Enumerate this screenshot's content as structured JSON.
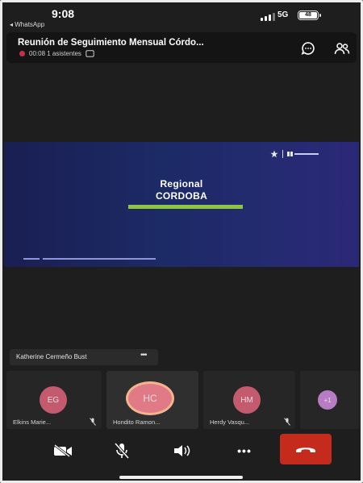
{
  "status_bar": {
    "time": "9:08",
    "back_app": "◂ WhatsApp",
    "network": "5G",
    "battery": "48"
  },
  "meeting": {
    "title": "Reunión de Seguimiento Mensual Córdo...",
    "duration_attendees": "00:08 1 asistentes"
  },
  "slide": {
    "title_line1": "Regional",
    "title_line2": "CORDOBA",
    "accent_color": "#8dc63f",
    "bg_color": "#1c2a66"
  },
  "speaker": {
    "name": "Katherine Cermeño Bust",
    "more": "•••"
  },
  "participants": [
    {
      "initials": "EG",
      "name": "Elkins Marie...",
      "color": "#c45a6e"
    },
    {
      "initials": "HC",
      "name": "Hondito Ramon...",
      "color": "#e07a86"
    },
    {
      "initials": "HM",
      "name": "Herdy Vasqu...",
      "color": "#c45a6e"
    },
    {
      "initials": "+1",
      "name": "",
      "color": "#b87cc4"
    }
  ],
  "controls": {
    "camera": "camera-off-icon",
    "mic": "mic-off-icon",
    "speaker": "speaker-icon",
    "more": "•••",
    "hangup": "hang-up-icon",
    "hangup_color": "#c42b1c"
  }
}
